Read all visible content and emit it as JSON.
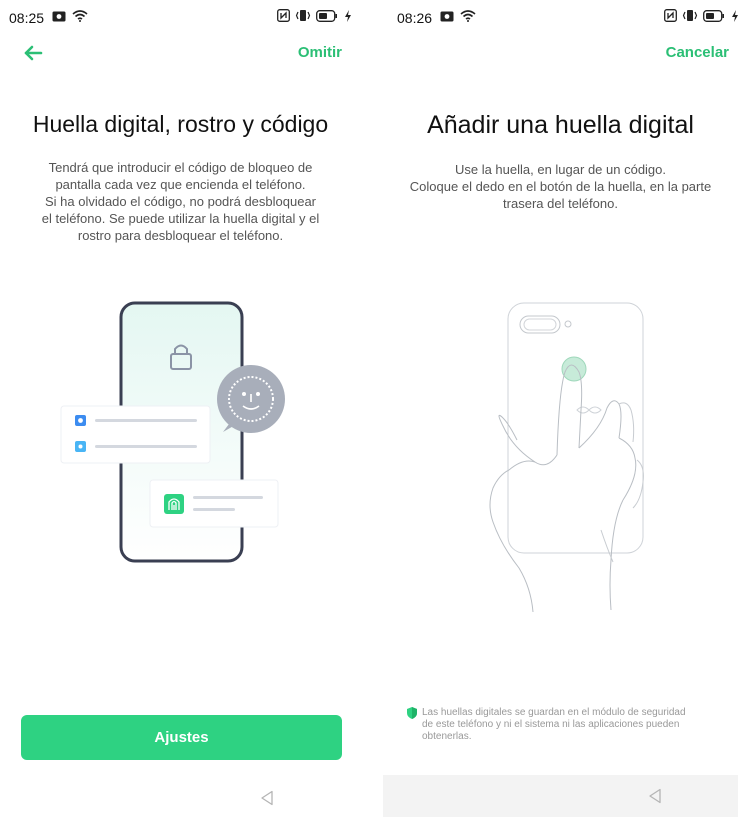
{
  "left": {
    "status": {
      "time": "08:25"
    },
    "header": {
      "action_label": "Omitir"
    },
    "title": "Huella digital, rostro y código",
    "description_lines": [
      "Tendrá que introducir el código de bloqueo de",
      "pantalla cada vez que encienda el teléfono.",
      "Si ha olvidado el código, no podrá desbloquear",
      "el teléfono. Se puede utilizar la huella digital y el",
      "rostro para desbloquear el teléfono."
    ],
    "button_label": "Ajustes"
  },
  "right": {
    "status": {
      "time": "08:26"
    },
    "header": {
      "action_label": "Cancelar"
    },
    "title": "Añadir una huella digital",
    "description_lines": [
      "Use la huella, en lugar de un código.",
      "Coloque el dedo en el botón de la huella, en la parte",
      "trasera del teléfono."
    ],
    "notice_lines": [
      "Las huellas digitales se guardan en el módulo de seguridad",
      "de este teléfono y ni el sistema ni las aplicaciones pueden",
      "obtenerlas."
    ]
  },
  "colors": {
    "accent": "#2bbf75",
    "button": "#2ed282",
    "nav_bar_right": "#f3f3f3"
  },
  "icons": {
    "back": "arrow-left-icon",
    "nav_back": "triangle-back-icon",
    "shield": "shield-icon",
    "lock": "lock-icon",
    "face": "face-icon",
    "fingerprint": "fingerprint-icon"
  }
}
